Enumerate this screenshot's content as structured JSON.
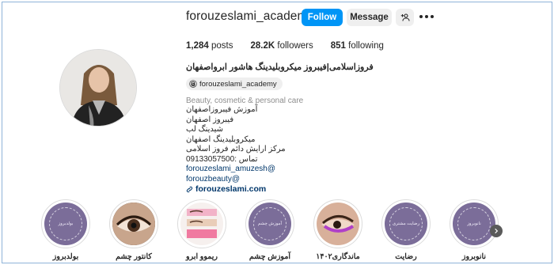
{
  "profile": {
    "username": "forouzeslami_academy",
    "follow_label": "Follow",
    "message_label": "Message",
    "stats": [
      {
        "value": "1,284",
        "label": "posts"
      },
      {
        "value": "28.2K",
        "label": "followers"
      },
      {
        "value": "851",
        "label": "following"
      }
    ],
    "full_name": "فروزاسلامی|فیبروز میکروبلیدینگ هاشور ابرواصفهان",
    "threads_handle": "forouzeslami_academy",
    "category": "Beauty, cosmetic & personal care",
    "bio_lines": [
      "آموزش فیبروزاصفهان",
      "فیبروز اصفهان",
      "شیدینگ لب",
      "میکروبلیدینگ اصفهان",
      "مرکز ارایش دائم فروز اسلامی",
      "تماس :09133057500"
    ],
    "mentions": [
      "forouzeslami_amuzesh@",
      "forouzbeauty@"
    ],
    "website": "forouzeslami.com"
  },
  "highlights": [
    {
      "label": "بولدبروز",
      "caption": "بولدبروز"
    },
    {
      "label": "کانتور چشم",
      "caption": ""
    },
    {
      "label": "ریموو ابرو",
      "caption": ""
    },
    {
      "label": "آموزش چشم",
      "caption": "آموزش چشم"
    },
    {
      "label": "ماندگاری۱۴۰۲",
      "caption": ""
    },
    {
      "label": "رضایت",
      "caption": "رضایت مشتری"
    },
    {
      "label": "نانوبروز",
      "caption": "نانوبروز"
    }
  ],
  "colors": {
    "follow_button": "#0095f6",
    "link": "#00376b",
    "highlight_purple": "#7b6d99"
  },
  "icons": [
    "suggest-user-icon",
    "more-options-icon",
    "threads-icon",
    "link-icon",
    "chevron-right-icon"
  ]
}
